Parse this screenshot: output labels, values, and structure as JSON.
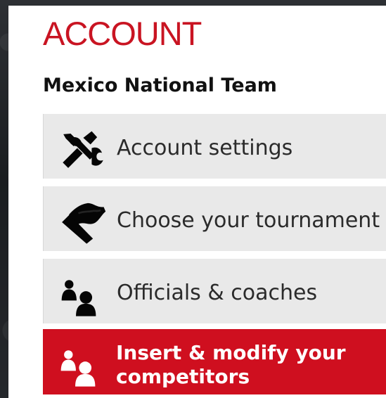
{
  "account": {
    "title": "ACCOUNT",
    "team_name": "Mexico National Team"
  },
  "menu": {
    "items": [
      {
        "label": "Account settings",
        "icon": "tools-icon",
        "selected": false
      },
      {
        "label": "Choose your tournament",
        "icon": "flag-icon",
        "selected": false
      },
      {
        "label": "Officials & coaches",
        "icon": "users-icon",
        "selected": false
      },
      {
        "label": "Insert & modify your competitors",
        "icon": "users-icon",
        "selected": true
      }
    ]
  },
  "colors": {
    "accent": "#c91422",
    "menu_background": "#e9e9e9",
    "selected_background": "#cf0f1f",
    "text_dark": "#111111",
    "text_menu": "#2b2b2b",
    "text_selected": "#ffffff"
  }
}
